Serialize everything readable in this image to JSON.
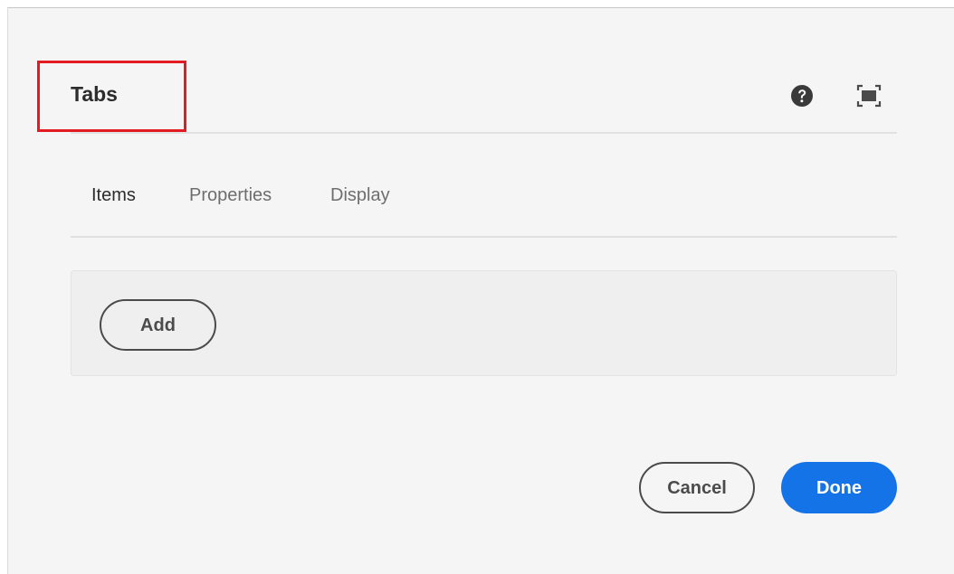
{
  "dialog": {
    "title": "Tabs",
    "help_icon": "help-circle-icon",
    "fullscreen_icon": "fullscreen-icon",
    "highlight_color": "#e31c23"
  },
  "tabs": [
    {
      "label": "Items",
      "active": true
    },
    {
      "label": "Properties",
      "active": false
    },
    {
      "label": "Display",
      "active": false
    }
  ],
  "items_panel": {
    "add_label": "Add"
  },
  "footer": {
    "cancel_label": "Cancel",
    "done_label": "Done",
    "primary_color": "#1473e6"
  }
}
